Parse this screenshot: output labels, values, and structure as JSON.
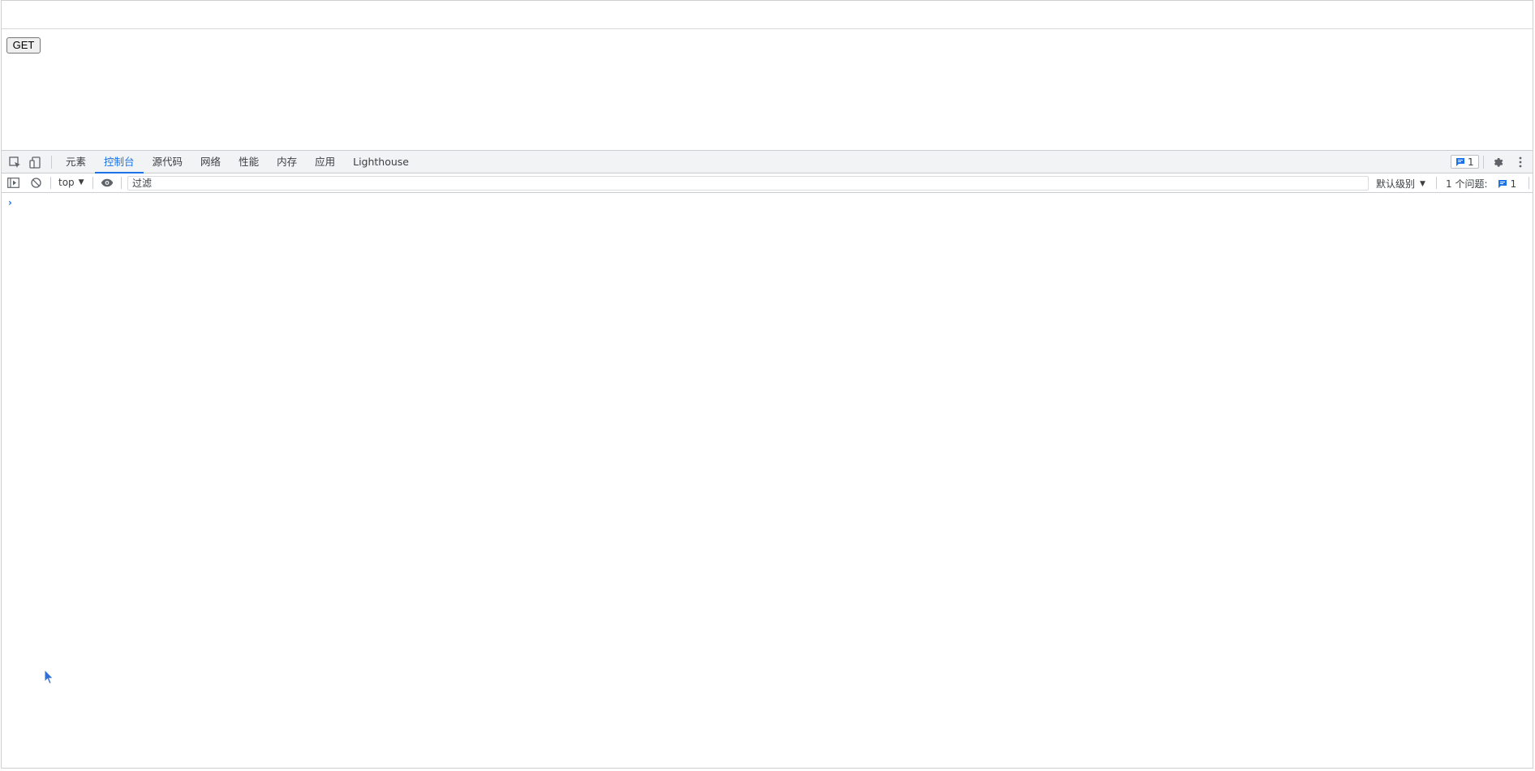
{
  "page": {
    "get_button_label": "GET"
  },
  "devtools": {
    "tabs": [
      {
        "label": "元素",
        "active": false
      },
      {
        "label": "控制台",
        "active": true
      },
      {
        "label": "源代码",
        "active": false
      },
      {
        "label": "网络",
        "active": false
      },
      {
        "label": "性能",
        "active": false
      },
      {
        "label": "内存",
        "active": false
      },
      {
        "label": "应用",
        "active": false
      },
      {
        "label": "Lighthouse",
        "active": false
      }
    ],
    "issues_badge_count": "1",
    "toolbar": {
      "context": "top",
      "filter_placeholder": "过滤",
      "level": "默认级别",
      "issues_label": "1 个问题:",
      "issues_count": "1"
    },
    "console_prompt": "›"
  },
  "colors": {
    "accent": "#1a73e8",
    "tabbar_bg": "#f1f3f4",
    "border": "#cacdd1"
  }
}
